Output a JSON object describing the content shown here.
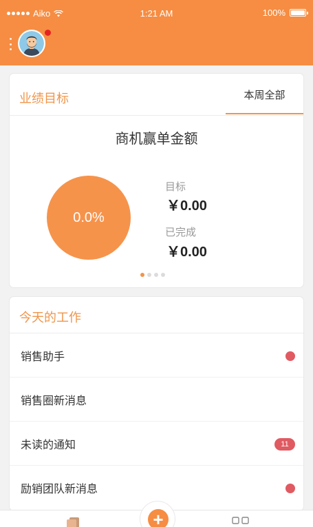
{
  "status_bar": {
    "carrier": "Aiko",
    "time": "1:21 AM",
    "battery": "100%"
  },
  "header": {
    "avatar_icon": "user-avatar-icon",
    "notification": true
  },
  "performance": {
    "title": "业绩目标",
    "tab_label": "本周全部",
    "metric_title": "商机赢单金额",
    "progress_percent": "0.0%",
    "target_label": "目标",
    "target_value": "￥0.00",
    "done_label": "已完成",
    "done_value": "￥0.00",
    "pager_count": 4,
    "pager_active_index": 0
  },
  "today_work": {
    "title": "今天的工作",
    "items": [
      {
        "label": "销售助手",
        "indicator": "dot"
      },
      {
        "label": "销售圈新消息",
        "indicator": "none"
      },
      {
        "label": "未读的通知",
        "indicator": "badge",
        "badge_text": "11"
      },
      {
        "label": "励销团队新消息",
        "indicator": "dot"
      }
    ]
  },
  "bottom_bar": {
    "fab_label": "+"
  },
  "colors": {
    "accent": "#f68d42",
    "badge": "#e05a62",
    "notification_dot": "#e52222"
  }
}
